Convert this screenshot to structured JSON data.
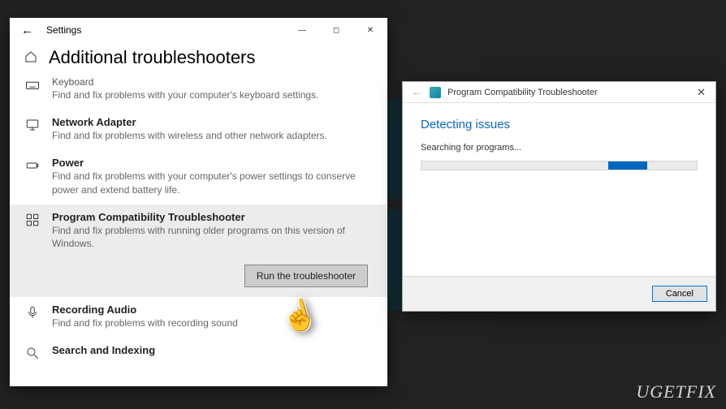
{
  "watermark": "UGETFIX",
  "settings": {
    "app_title": "Settings",
    "page_title": "Additional troubleshooters",
    "run_button": "Run the troubleshooter",
    "items": [
      {
        "title": "Keyboard",
        "desc": "Find and fix problems with your computer's keyboard settings."
      },
      {
        "title": "Network Adapter",
        "desc": "Find and fix problems with wireless and other network adapters."
      },
      {
        "title": "Power",
        "desc": "Find and fix problems with your computer's power settings to conserve power and extend battery life."
      },
      {
        "title": "Program Compatibility Troubleshooter",
        "desc": "Find and fix problems with running older programs on this version of Windows."
      },
      {
        "title": "Recording Audio",
        "desc": "Find and fix problems with recording sound"
      },
      {
        "title": "Search and Indexing",
        "desc": ""
      }
    ]
  },
  "dialog": {
    "title": "Program Compatibility Troubleshooter",
    "heading": "Detecting issues",
    "status": "Searching for programs...",
    "cancel": "Cancel"
  }
}
